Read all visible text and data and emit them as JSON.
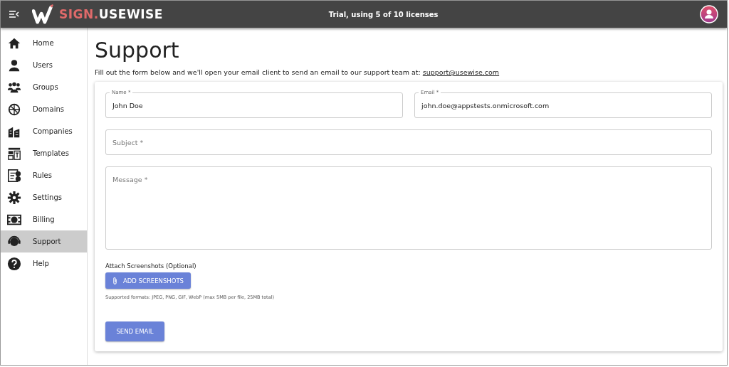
{
  "header": {
    "logo_prefix": "SIGN.",
    "logo_suffix": "USEWISE",
    "license_status": "Trial, using 5 of 10 licenses"
  },
  "sidebar": {
    "items": [
      {
        "label": "Home",
        "selected": false
      },
      {
        "label": "Users",
        "selected": false
      },
      {
        "label": "Groups",
        "selected": false
      },
      {
        "label": "Domains",
        "selected": false
      },
      {
        "label": "Companies",
        "selected": false
      },
      {
        "label": "Templates",
        "selected": false
      },
      {
        "label": "Rules",
        "selected": false
      },
      {
        "label": "Settings",
        "selected": false
      },
      {
        "label": "Billing",
        "selected": false
      },
      {
        "label": "Support",
        "selected": true
      },
      {
        "label": "Help",
        "selected": false
      }
    ]
  },
  "page": {
    "title": "Support",
    "intro": "Fill out the form below and we'll open your email client to send an email to our support team at:",
    "support_link": "support@usewise.com"
  },
  "form": {
    "fields": [
      {
        "kind": "text",
        "label": "Name *",
        "value": "John Doe"
      },
      {
        "kind": "text",
        "label": "Email *",
        "value": "john.doe@appstests.onmicrosoft.com"
      },
      {
        "kind": "text",
        "placeholder": "Subject *"
      },
      {
        "kind": "textarea",
        "placeholder": "Message *"
      }
    ],
    "attach_label": "Attach Screenshots (Optional)",
    "attach_button": "ADD SCREENSHOTS",
    "formats_note": "Supported formats: JPEG, PNG, GIF, WebP (max 5MB per file, 25MB total)",
    "submit_button": "SEND EMAIL"
  }
}
